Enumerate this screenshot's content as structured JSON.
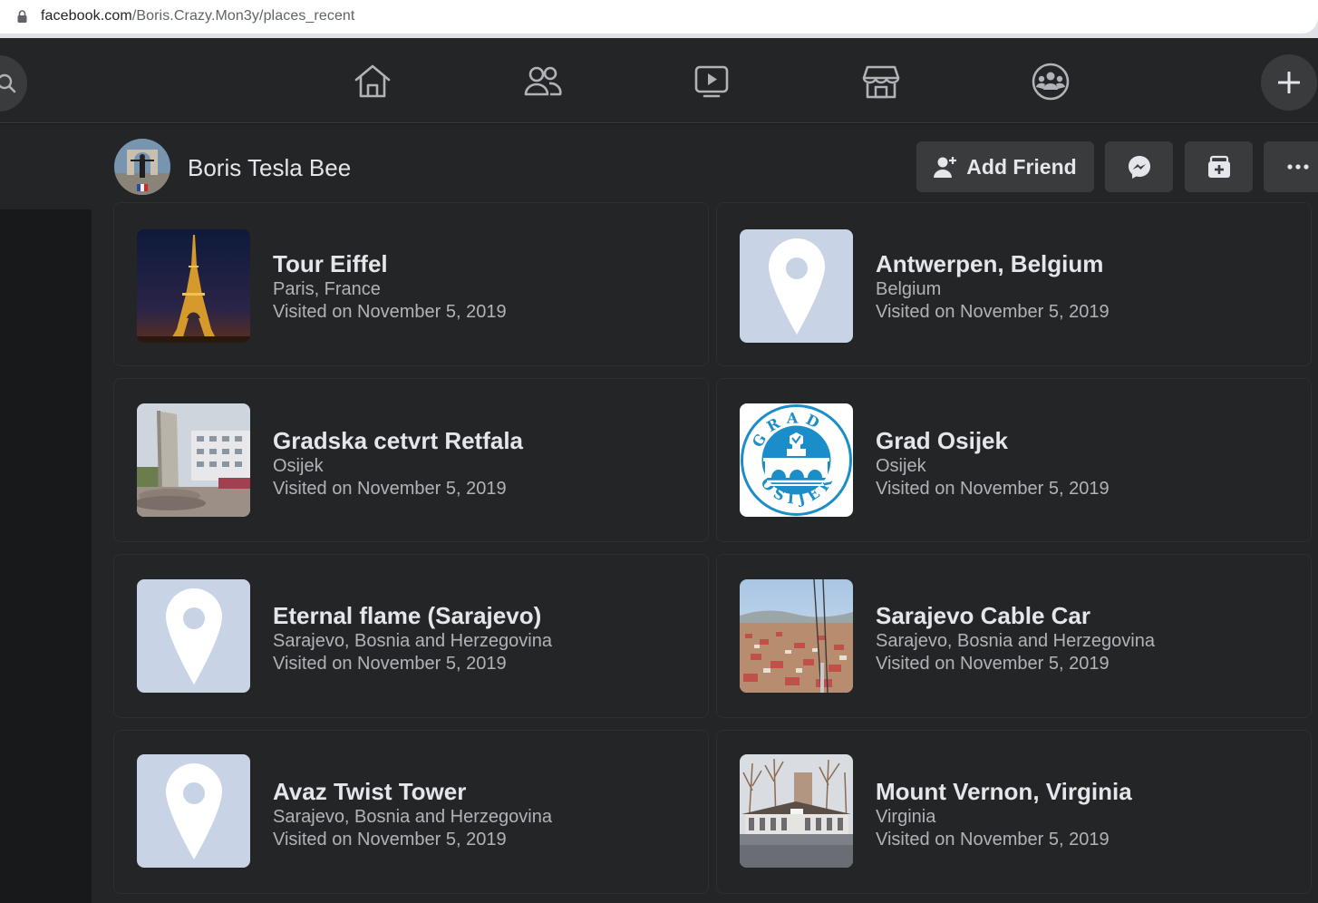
{
  "browser": {
    "url_domain": "facebook.com",
    "url_path": "/Boris.Crazy.Mon3y/places_recent"
  },
  "topnav": {
    "icons": [
      "home-icon",
      "friends-icon",
      "watch-icon",
      "marketplace-icon",
      "groups-icon"
    ]
  },
  "profile": {
    "name": "Boris Tesla Bee",
    "add_friend_label": "Add Friend"
  },
  "places": [
    {
      "name": "Tour Eiffel",
      "location": "Paris, France",
      "visited": "Visited on November 5, 2019",
      "thumb": "eiffel-photo"
    },
    {
      "name": "Antwerpen, Belgium",
      "location": "Belgium",
      "visited": "Visited on November 5, 2019",
      "thumb": "map-pin-icon"
    },
    {
      "name": "Gradska cetvrt Retfala",
      "location": "Osijek",
      "visited": "Visited on November 5, 2019",
      "thumb": "retfala-photo"
    },
    {
      "name": "Grad Osijek",
      "location": "Osijek",
      "visited": "Visited on November 5, 2019",
      "thumb": "osijek-seal",
      "seal_top": "GRAD",
      "seal_bottom": "OSIJEK"
    },
    {
      "name": "Eternal flame (Sarajevo)",
      "location": "Sarajevo, Bosnia and Herzegovina",
      "visited": "Visited on November 5, 2019",
      "thumb": "map-pin-icon"
    },
    {
      "name": "Sarajevo Cable Car",
      "location": "Sarajevo, Bosnia and Herzegovina",
      "visited": "Visited on November 5, 2019",
      "thumb": "cable-car-photo"
    },
    {
      "name": "Avaz Twist Tower",
      "location": "Sarajevo, Bosnia and Herzegovina",
      "visited": "Visited on November 5, 2019",
      "thumb": "map-pin-icon"
    },
    {
      "name": "Mount Vernon, Virginia",
      "location": "Virginia",
      "visited": "Visited on November 5, 2019",
      "thumb": "mount-vernon-photo"
    }
  ],
  "colors": {
    "background": "#18191a",
    "surface": "#242526",
    "button": "#3a3b3c",
    "text_primary": "#e4e6eb",
    "text_secondary": "#b0b3b8",
    "pin_placeholder": "#c8d3e6"
  }
}
